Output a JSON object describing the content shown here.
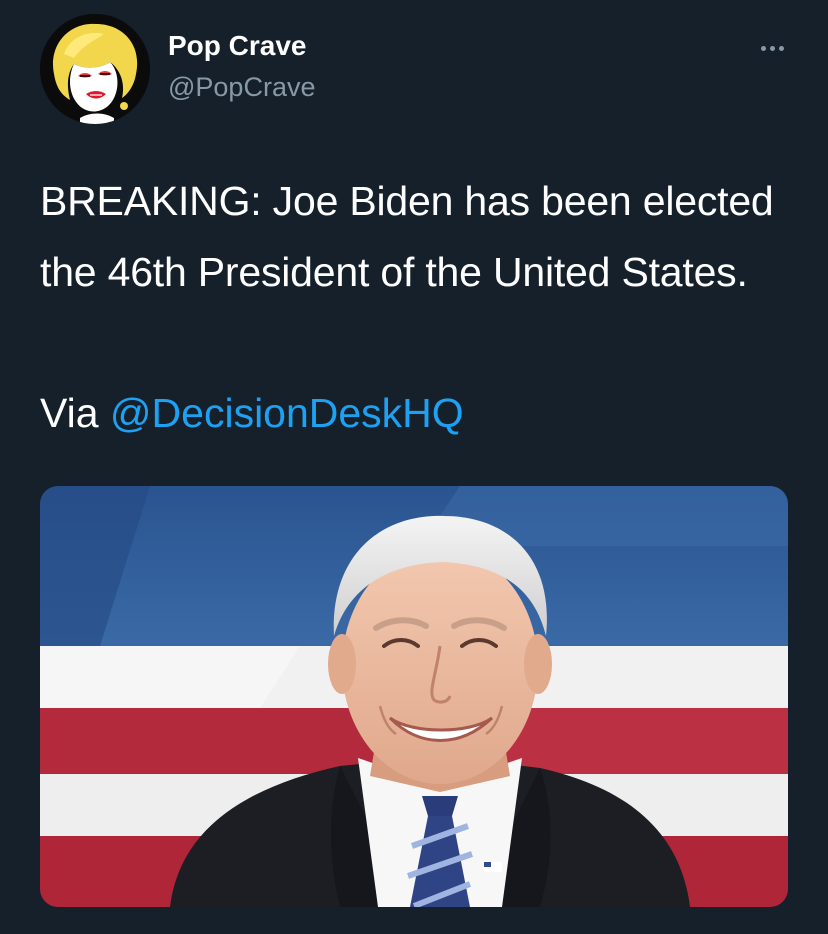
{
  "tweet": {
    "display_name": "Pop Crave",
    "handle": "@PopCrave",
    "text": "BREAKING: Joe Biden has been elected the 46th President of the United States.",
    "via_prefix": "Via ",
    "mention": "@DecisionDeskHQ",
    "more_icon": "more-horizontal-icon",
    "avatar_icon": "avatar-portrait",
    "media": {
      "alt": "Photo of Joe Biden in front of a stylized American flag background"
    }
  },
  "colors": {
    "background": "#15202b",
    "text": "#ffffff",
    "secondary_text": "#8899a6",
    "link": "#1da1f2",
    "flag_blue": "#2f5a94",
    "flag_red": "#b3263a"
  }
}
